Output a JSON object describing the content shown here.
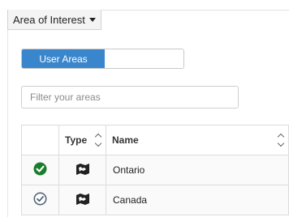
{
  "header": {
    "dropdown_label": "Area of Interest"
  },
  "toggle": {
    "active_label": "User Areas",
    "inactive_label": ""
  },
  "filter": {
    "placeholder": "Filter your areas",
    "value": ""
  },
  "table": {
    "columns": {
      "type": "Type",
      "name": "Name"
    },
    "rows": [
      {
        "name": "Ontario",
        "selected": true,
        "type_icon": "map-icon"
      },
      {
        "name": "Canada",
        "selected": false,
        "type_icon": "map-icon"
      }
    ]
  },
  "colors": {
    "accent": "#3a86cc",
    "check_on": "#1a7d2c",
    "check_off": "#556677"
  }
}
